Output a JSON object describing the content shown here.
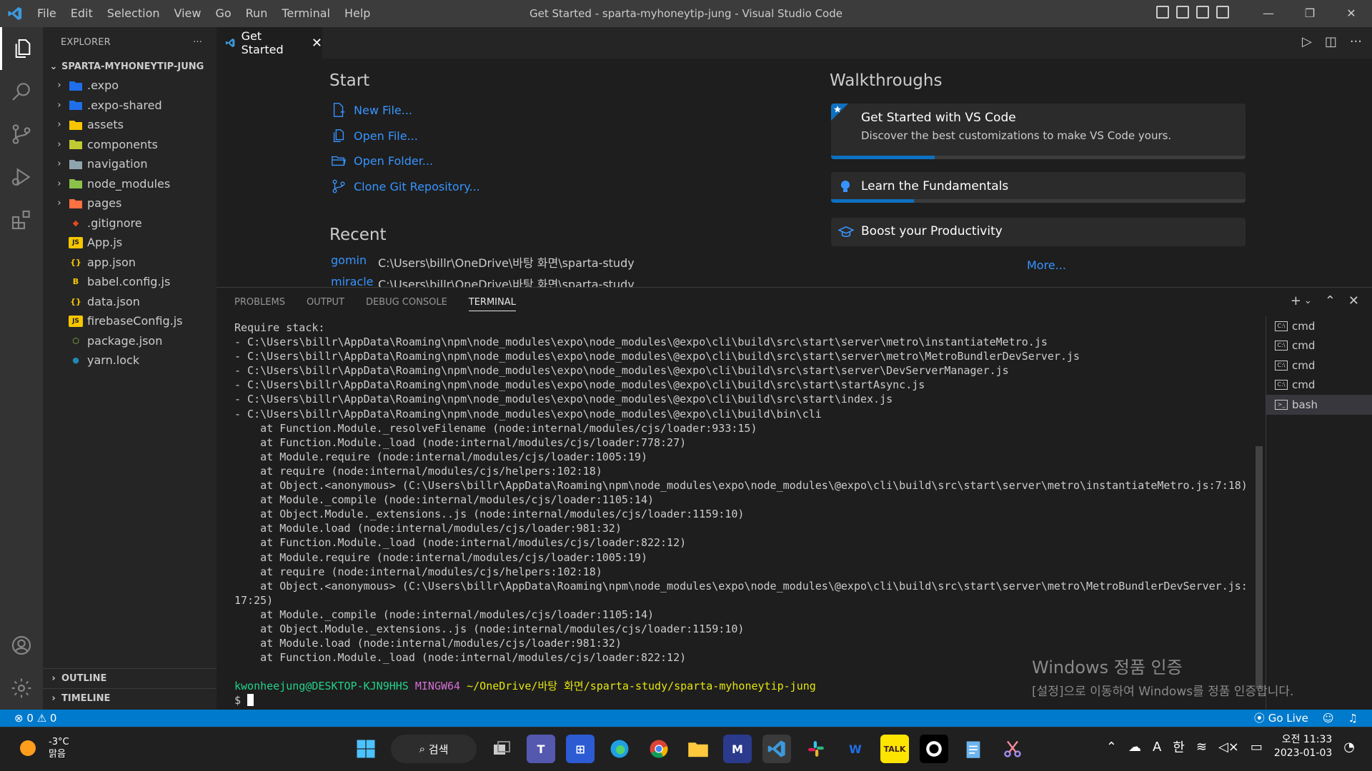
{
  "window": {
    "title": "Get Started - sparta-myhoneytip-jung - Visual Studio Code",
    "menu": [
      "File",
      "Edit",
      "Selection",
      "View",
      "Go",
      "Run",
      "Terminal",
      "Help"
    ]
  },
  "sidebar": {
    "header": "EXPLORER",
    "more": "···",
    "root": "SPARTA-MYHONEYTIP-JUNG",
    "items": [
      {
        "label": ".expo",
        "type": "folder",
        "icon": "expo-folder-icon",
        "color": "#1f6feb"
      },
      {
        "label": ".expo-shared",
        "type": "folder",
        "icon": "expo-folder-icon",
        "color": "#1f6feb"
      },
      {
        "label": "assets",
        "type": "folder",
        "icon": "folder-icon",
        "color": "#f7c600"
      },
      {
        "label": "components",
        "type": "folder",
        "icon": "folder-icon",
        "color": "#c0ca33"
      },
      {
        "label": "navigation",
        "type": "folder",
        "icon": "folder-icon",
        "color": "#90a4ae"
      },
      {
        "label": "node_modules",
        "type": "folder",
        "icon": "folder-icon",
        "color": "#8bc34a"
      },
      {
        "label": "pages",
        "type": "folder",
        "icon": "folder-icon",
        "color": "#ff7043"
      },
      {
        "label": ".gitignore",
        "type": "file",
        "icon": "git-icon",
        "color": "#e64a19"
      },
      {
        "label": "App.js",
        "type": "file",
        "icon": "js-icon",
        "color": "#f7c600"
      },
      {
        "label": "app.json",
        "type": "file",
        "icon": "json-icon",
        "color": "#f7c600"
      },
      {
        "label": "babel.config.js",
        "type": "file",
        "icon": "babel-icon",
        "color": "#f7c600"
      },
      {
        "label": "data.json",
        "type": "file",
        "icon": "json-icon",
        "color": "#f7c600"
      },
      {
        "label": "firebaseConfig.js",
        "type": "file",
        "icon": "js-icon",
        "color": "#f7c600"
      },
      {
        "label": "package.json",
        "type": "file",
        "icon": "npm-icon",
        "color": "#8bc34a"
      },
      {
        "label": "yarn.lock",
        "type": "file",
        "icon": "yarn-icon",
        "color": "#2188b6"
      }
    ],
    "outline": "OUTLINE",
    "timeline": "TIMELINE"
  },
  "tab": {
    "label": "Get Started",
    "close": "✕"
  },
  "welcome": {
    "start_heading": "Start",
    "start_links": [
      "New File...",
      "Open File...",
      "Open Folder...",
      "Clone Git Repository..."
    ],
    "recent_heading": "Recent",
    "recent": [
      {
        "name": "gomin",
        "path": "C:\\Users\\billr\\OneDrive\\바탕 화면\\sparta-study"
      },
      {
        "name": "miracle",
        "path": "C:\\Users\\billr\\OneDrive\\바탕 화면\\sparta-study"
      }
    ],
    "walkthroughs_heading": "Walkthroughs",
    "walkthroughs": [
      {
        "title": "Get Started with VS Code",
        "description": "Discover the best customizations to make VS Code yours.",
        "progress": 0.25
      },
      {
        "title": "Learn the Fundamentals",
        "progress": 0.2
      },
      {
        "title": "Boost your Productivity"
      }
    ],
    "more": "More..."
  },
  "panel": {
    "tabs": [
      "PROBLEMS",
      "OUTPUT",
      "DEBUG CONSOLE",
      "TERMINAL"
    ],
    "active_tab": "TERMINAL",
    "terminal_lines": [
      "Require stack:",
      "- C:\\Users\\billr\\AppData\\Roaming\\npm\\node_modules\\expo\\node_modules\\@expo\\cli\\build\\src\\start\\server\\metro\\instantiateMetro.js",
      "- C:\\Users\\billr\\AppData\\Roaming\\npm\\node_modules\\expo\\node_modules\\@expo\\cli\\build\\src\\start\\server\\metro\\MetroBundlerDevServer.js",
      "- C:\\Users\\billr\\AppData\\Roaming\\npm\\node_modules\\expo\\node_modules\\@expo\\cli\\build\\src\\start\\server\\DevServerManager.js",
      "- C:\\Users\\billr\\AppData\\Roaming\\npm\\node_modules\\expo\\node_modules\\@expo\\cli\\build\\src\\start\\startAsync.js",
      "- C:\\Users\\billr\\AppData\\Roaming\\npm\\node_modules\\expo\\node_modules\\@expo\\cli\\build\\src\\start\\index.js",
      "- C:\\Users\\billr\\AppData\\Roaming\\npm\\node_modules\\expo\\node_modules\\@expo\\cli\\build\\bin\\cli",
      "    at Function.Module._resolveFilename (node:internal/modules/cjs/loader:933:15)",
      "    at Function.Module._load (node:internal/modules/cjs/loader:778:27)",
      "    at Module.require (node:internal/modules/cjs/loader:1005:19)",
      "    at require (node:internal/modules/cjs/helpers:102:18)",
      "    at Object.<anonymous> (C:\\Users\\billr\\AppData\\Roaming\\npm\\node_modules\\expo\\node_modules\\@expo\\cli\\build\\src\\start\\server\\metro\\instantiateMetro.js:7:18)",
      "    at Module._compile (node:internal/modules/cjs/loader:1105:14)",
      "    at Object.Module._extensions..js (node:internal/modules/cjs/loader:1159:10)",
      "    at Module.load (node:internal/modules/cjs/loader:981:32)",
      "    at Function.Module._load (node:internal/modules/cjs/loader:822:12)",
      "    at Module.require (node:internal/modules/cjs/loader:1005:19)",
      "    at require (node:internal/modules/cjs/helpers:102:18)",
      "    at Object.<anonymous> (C:\\Users\\billr\\AppData\\Roaming\\npm\\node_modules\\expo\\node_modules\\@expo\\cli\\build\\src\\start\\server\\metro\\MetroBundlerDevServer.js:",
      "17:25)",
      "    at Module._compile (node:internal/modules/cjs/loader:1105:14)",
      "    at Object.Module._extensions..js (node:internal/modules/cjs/loader:1159:10)",
      "    at Module.load (node:internal/modules/cjs/loader:981:32)",
      "    at Function.Module._load (node:internal/modules/cjs/loader:822:12)",
      ""
    ],
    "prompt": {
      "user": "kwonheejung@DESKTOP-KJN9HHS",
      "shell": "MINGW64",
      "path": "~/OneDrive/바탕 화면/sparta-study/sparta-myhoneytip-jung",
      "symbol": "$"
    },
    "terminals": [
      "cmd",
      "cmd",
      "cmd",
      "cmd",
      "bash"
    ],
    "active_terminal": "bash"
  },
  "watermark": {
    "title": "Windows 정품 인증",
    "subtitle": "[설정]으로 이동하여 Windows를 정품 인증합니다."
  },
  "statusbar": {
    "errors": "0",
    "warnings": "0",
    "go_live": "Go Live"
  },
  "taskbar": {
    "temperature": "-3°C",
    "condition": "맑음",
    "search": "검색",
    "ime_letter": "A",
    "ime_lang": "한",
    "time": "오전 11:33",
    "date": "2023-01-03",
    "apps": [
      "windows-start-icon",
      "task-view-icon",
      "teams-icon",
      "store-icon",
      "edge-icon",
      "chrome-icon",
      "file-explorer-icon",
      "app-icon",
      "vscode-icon",
      "slack-icon",
      "app-icon",
      "kakaotalk-icon",
      "obs-icon",
      "notepad-icon",
      "snipping-tool-icon"
    ]
  },
  "colors": {
    "accent": "#007acc",
    "link": "#3794ff",
    "editor_bg": "#1e1e1e",
    "sidebar_bg": "#252526",
    "titlebar_bg": "#3c3c3c"
  }
}
